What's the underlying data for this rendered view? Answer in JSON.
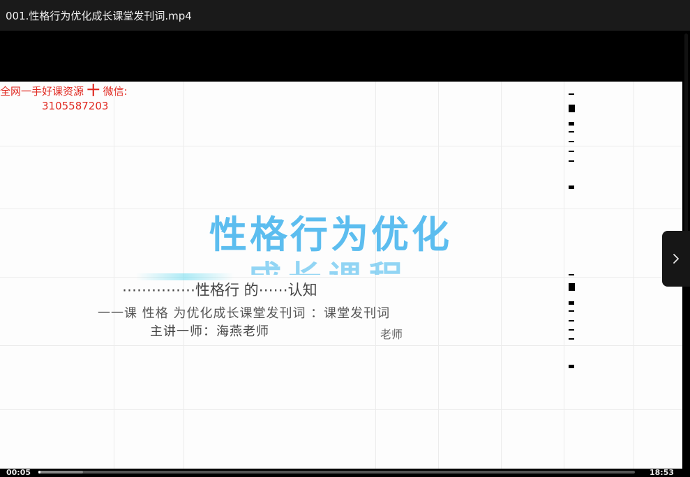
{
  "window": {
    "title": "001.性格行为优化成长课堂发刊词.mp4"
  },
  "video": {
    "watermark_line1": "全网一手好课资源",
    "watermark_plus": "十",
    "watermark_wechat": "微信:",
    "watermark_line2": "3105587203",
    "title_line1": "性格行为优化",
    "title_line2": "成长课程",
    "subtitle_line1": "⋯⋯⋯⋯⋯性格行  的⋯⋯认知",
    "subtitle_line2": "一一课  性格  为优化成长课堂发刊词  ：课堂发刊词",
    "subtitle_line3": "主讲一师：海燕老师",
    "subtitle_line4": "老师"
  },
  "controls": {
    "time_current": "00:05",
    "time_total": "18:53",
    "progress_played": 0.004,
    "progress_buffered": 0.075,
    "next_icon": "chevron-right-icon"
  },
  "colors": {
    "watermark": "#e02a22",
    "title_blue": "#4fb8ee"
  }
}
